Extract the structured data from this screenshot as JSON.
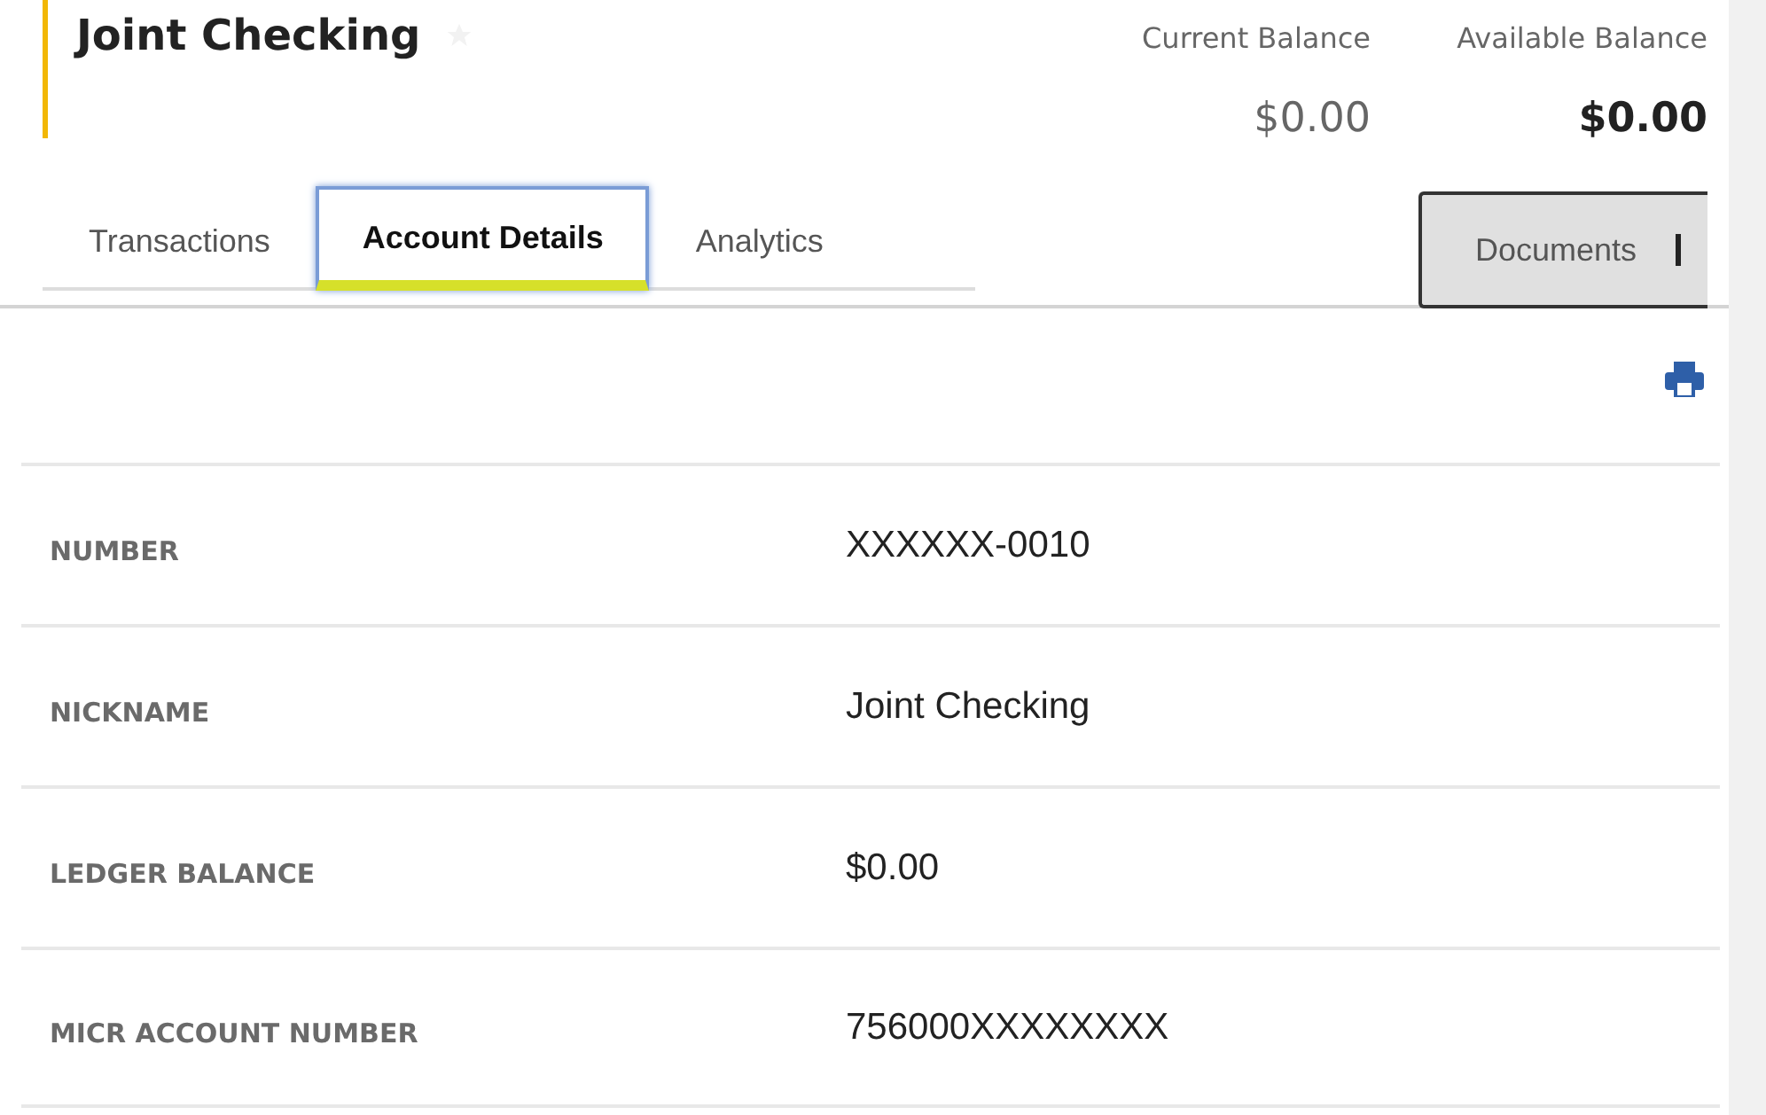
{
  "account": {
    "title": "Joint Checking",
    "favorite": false
  },
  "balances": [
    {
      "label": "Current Balance",
      "value": "$0.00",
      "emphasis": false
    },
    {
      "label": "Available Balance",
      "value": "$0.00",
      "emphasis": true
    }
  ],
  "tabs": [
    {
      "label": "Transactions",
      "selected": false
    },
    {
      "label": "Account Details",
      "selected": true
    },
    {
      "label": "Analytics",
      "selected": false
    }
  ],
  "documents_button": {
    "label": "Documents"
  },
  "details": [
    {
      "label": "NUMBER",
      "value": "XXXXXX-0010"
    },
    {
      "label": "NICKNAME",
      "value": "Joint Checking"
    },
    {
      "label": "LEDGER BALANCE",
      "value": "$0.00"
    },
    {
      "label": "MICR ACCOUNT NUMBER",
      "value": "756000XXXXXXXX"
    }
  ]
}
